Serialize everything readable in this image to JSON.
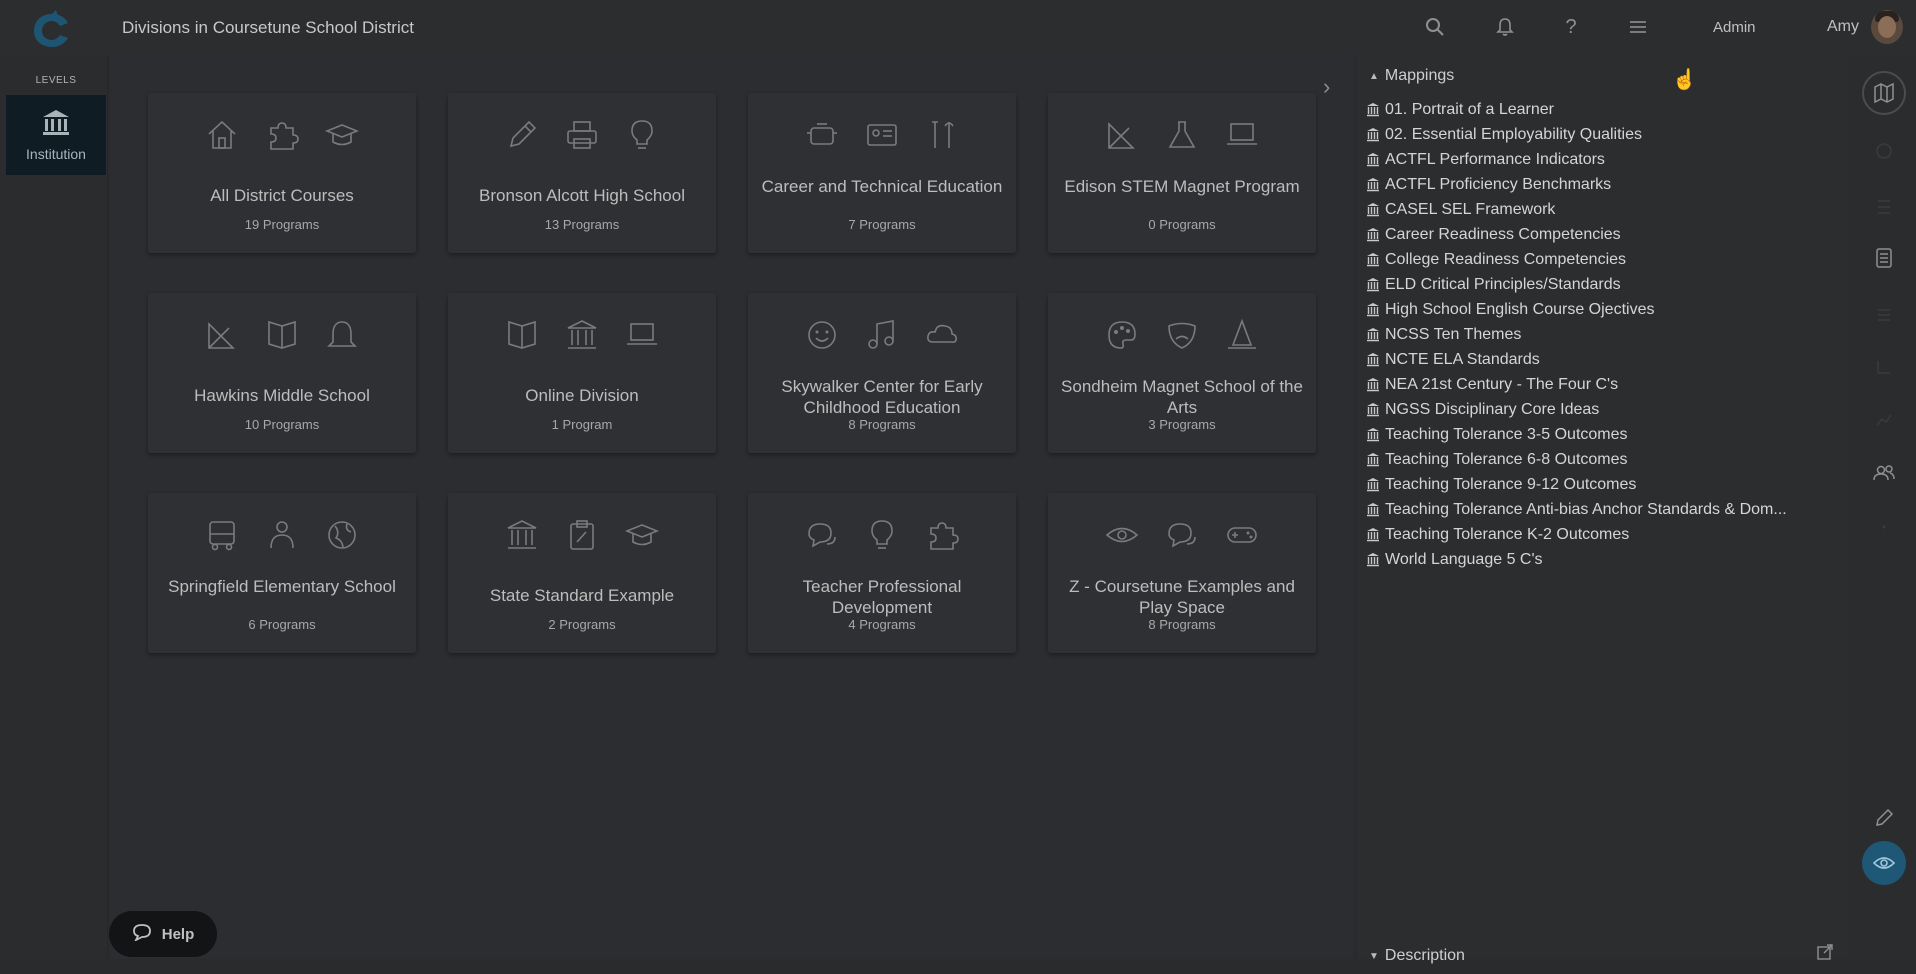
{
  "app": {
    "title": "Divisions in Coursetune School District"
  },
  "topbar": {
    "admin_label": "Admin",
    "user_name": "Amy",
    "icons": [
      "search-icon",
      "bell-icon",
      "help-icon",
      "menu-icon"
    ]
  },
  "levels": {
    "label": "LEVELS",
    "items": [
      {
        "label": "Institution",
        "icon": "institution-icon"
      }
    ]
  },
  "divisions": [
    {
      "name": "All District Courses",
      "count": "19 Programs",
      "icons": [
        "house",
        "puzzle",
        "grad-cap"
      ]
    },
    {
      "name": "Bronson Alcott High School",
      "count": "13 Programs",
      "icons": [
        "pencil",
        "printer",
        "bulb"
      ]
    },
    {
      "name": "Career and Technical Education",
      "count": "7 Programs",
      "icons": [
        "engine",
        "id-card",
        "tools"
      ]
    },
    {
      "name": "Edison STEM Magnet Program",
      "count": "0 Programs",
      "icons": [
        "ruler",
        "flask",
        "laptop"
      ]
    },
    {
      "name": "Hawkins Middle School",
      "count": "10 Programs",
      "icons": [
        "ruler",
        "book",
        "bell"
      ]
    },
    {
      "name": "Online Division",
      "count": "1 Program",
      "icons": [
        "book",
        "building",
        "laptop"
      ]
    },
    {
      "name": "Skywalker Center for Early Childhood Education",
      "count": "8 Programs",
      "icons": [
        "smiley",
        "note",
        "cloud"
      ]
    },
    {
      "name": "Sondheim Magnet School of the Arts",
      "count": "3 Programs",
      "icons": [
        "palette",
        "masks",
        "cone"
      ]
    },
    {
      "name": "Springfield Elementary School",
      "count": "6 Programs",
      "icons": [
        "bus",
        "person",
        "globe"
      ]
    },
    {
      "name": "State Standard Example",
      "count": "2 Programs",
      "icons": [
        "building",
        "clipboard",
        "grad-cap"
      ]
    },
    {
      "name": "Teacher Professional Development",
      "count": "4 Programs",
      "icons": [
        "chat",
        "bulb",
        "puzzle"
      ]
    },
    {
      "name": "Z - Coursetune Examples and Play Space",
      "count": "8 Programs",
      "icons": [
        "eye",
        "chat",
        "gamepad"
      ]
    }
  ],
  "mappings": {
    "header": "Mappings",
    "items": [
      "01. Portrait of a Learner",
      "02. Essential Employability Qualities",
      "ACTFL Performance Indicators",
      "ACTFL Proficiency Benchmarks",
      "CASEL SEL Framework",
      "Career Readiness Competencies",
      "College Readiness Competencies",
      "ELD Critical Principles/Standards",
      "High School English Course Ojectives",
      "NCSS Ten Themes",
      "NCTE ELA Standards",
      "NEA 21st Century - The Four C's",
      "NGSS Disciplinary Core Ideas",
      "Teaching Tolerance 3-5 Outcomes",
      "Teaching Tolerance 6-8 Outcomes",
      "Teaching Tolerance 9-12 Outcomes",
      "Teaching Tolerance Anti-bias Anchor Standards & Dom...",
      "Teaching Tolerance K-2 Outcomes",
      "World Language 5 C's"
    ]
  },
  "description": {
    "header": "Description"
  },
  "help": {
    "label": "Help"
  }
}
